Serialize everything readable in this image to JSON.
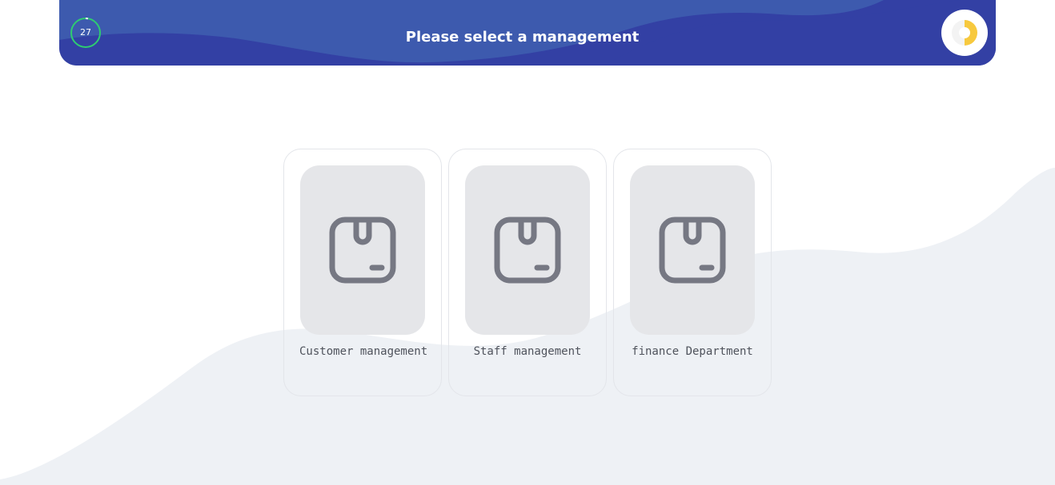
{
  "header": {
    "title": "Please select a management",
    "timer_value": "27",
    "timer_progress": 0.97,
    "brand_icon": "donut-logo-icon",
    "colors": {
      "header_bg": "#3340a4",
      "header_wave": "#3d5aae",
      "timer_ring": "#2ecc71",
      "brand_accent": "#f7c93e"
    }
  },
  "cards": [
    {
      "label": "Customer management",
      "icon": "package-box-icon"
    },
    {
      "label": "Staff management",
      "icon": "package-box-icon"
    },
    {
      "label": "finance Department",
      "icon": "package-box-icon"
    }
  ],
  "colors": {
    "background_wave": "#eef1f5",
    "card_thumb": "#e5e6e9",
    "icon": "#767883"
  }
}
